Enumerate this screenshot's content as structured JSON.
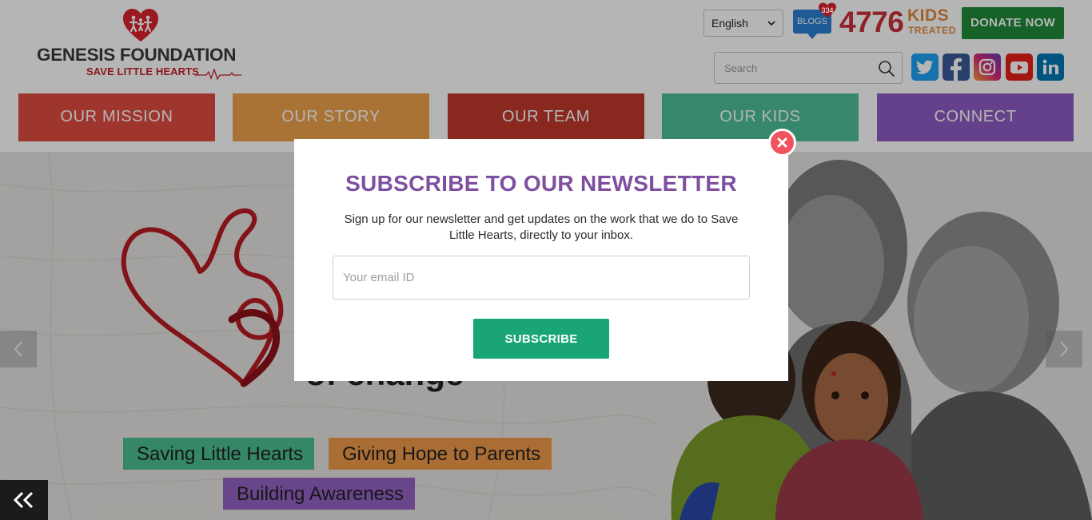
{
  "header": {
    "logo": {
      "name": "GENESIS FOUNDATION",
      "tagline": "SAVE LITTLE HEARTS"
    },
    "language": {
      "selected": "English"
    },
    "blogs": {
      "label": "BLOGS",
      "count": "334"
    },
    "stats": {
      "count": "4776",
      "label": "KIDS",
      "sublabel": "TREATED"
    },
    "donate_label": "DONATE NOW",
    "search": {
      "placeholder": "Search"
    },
    "social": [
      "twitter-icon",
      "facebook-icon",
      "instagram-icon",
      "youtube-icon",
      "linkedin-icon"
    ]
  },
  "nav": {
    "items": [
      {
        "label": "OUR MISSION",
        "color": "#e14d41"
      },
      {
        "label": "OUR STORY",
        "color": "#eea24b"
      },
      {
        "label": "OUR TEAM",
        "color": "#c0392b"
      },
      {
        "label": "OUR KIDS",
        "color": "#4dbf98"
      },
      {
        "label": "CONNECT",
        "color": "#8e5cc3"
      }
    ]
  },
  "hero": {
    "headline_fragment": "of change",
    "pills": [
      {
        "label": "Saving Little Hearts",
        "color": "#4bbf93"
      },
      {
        "label": "Giving Hope to Parents",
        "color": "#f09a4a"
      },
      {
        "label": "Building Awareness",
        "color": "#9563c6"
      }
    ]
  },
  "modal": {
    "title": "SUBSCRIBE TO OUR NEWSLETTER",
    "description": "Sign up for our newsletter and get updates on the work that we do to Save Little Hearts, directly to your inbox.",
    "email_placeholder": "Your email ID",
    "subscribe_label": "SUBSCRIBE"
  },
  "colors": {
    "brand_red": "#c8232c",
    "accent_orange": "#e08a3c",
    "donate_green": "#1f8a3b",
    "subscribe_green": "#1aa579",
    "title_purple": "#7e4fa0",
    "close_red": "#f0525e"
  }
}
